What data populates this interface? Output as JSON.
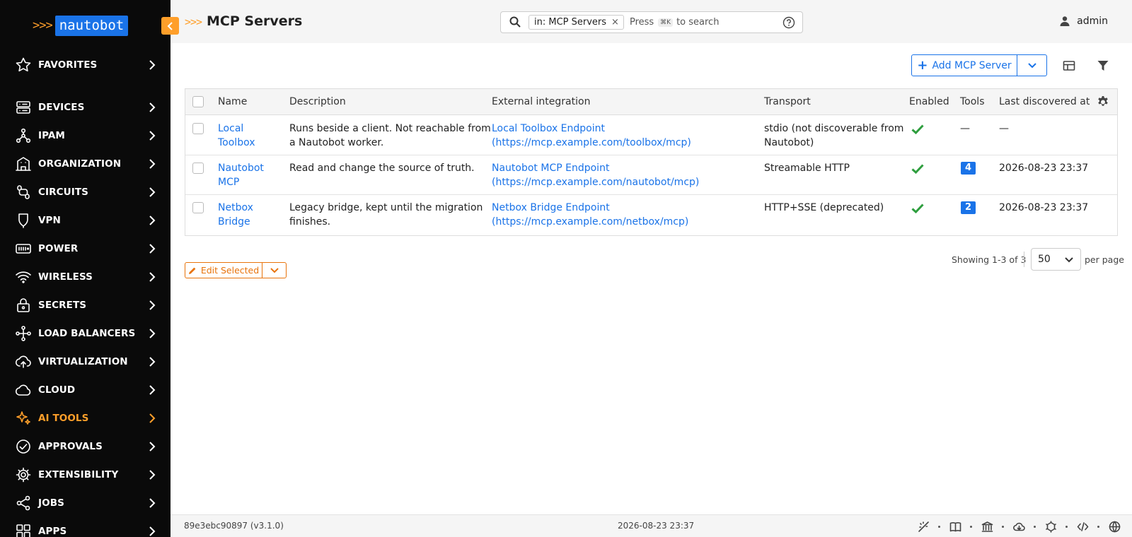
{
  "brand": {
    "chevrons": ">>>",
    "name": "nautobot"
  },
  "sidebar": {
    "items": [
      {
        "label": "FAVORITES",
        "icon": "star-icon"
      },
      {
        "label": "DEVICES",
        "icon": "server-icon"
      },
      {
        "label": "IPAM",
        "icon": "network-icon"
      },
      {
        "label": "ORGANIZATION",
        "icon": "building-icon"
      },
      {
        "label": "CIRCUITS",
        "icon": "circuit-icon"
      },
      {
        "label": "VPN",
        "icon": "shield-icon"
      },
      {
        "label": "POWER",
        "icon": "power-strip-icon"
      },
      {
        "label": "WIRELESS",
        "icon": "wifi-icon"
      },
      {
        "label": "SECRETS",
        "icon": "lock-icon"
      },
      {
        "label": "LOAD BALANCERS",
        "icon": "load-balancer-icon"
      },
      {
        "label": "VIRTUALIZATION",
        "icon": "cloud-upload-icon"
      },
      {
        "label": "CLOUD",
        "icon": "cloud-icon"
      },
      {
        "label": "AI TOOLS",
        "icon": "sparkle-icon",
        "active": true
      },
      {
        "label": "APPROVALS",
        "icon": "check-circle-icon"
      },
      {
        "label": "EXTENSIBILITY",
        "icon": "gear-icon"
      },
      {
        "label": "JOBS",
        "icon": "share-nodes-icon"
      },
      {
        "label": "APPS",
        "icon": "grid-icon"
      }
    ]
  },
  "header": {
    "title_chevrons": ">>>",
    "title": "MCP Servers",
    "search": {
      "chip": "in: MCP Servers",
      "chip_close": "×",
      "press": "Press",
      "shortcut": "⌘K",
      "suffix": "to search"
    },
    "user": "admin"
  },
  "toolbar": {
    "add_label": "Add MCP Server"
  },
  "table": {
    "columns": [
      "Name",
      "Description",
      "External integration",
      "Transport",
      "Enabled",
      "Tools",
      "Last discovered at"
    ],
    "rows": [
      {
        "name_line1": "Local",
        "name_line2": "Toolbox",
        "desc_line1": "Runs beside a client. Not reachable from",
        "desc_line2": "a Nautobot worker.",
        "ext_line1": "Local Toolbox Endpoint",
        "ext_line2": "(https://mcp.example.com/toolbox/mcp)",
        "transport_line1": "stdio (not discoverable from",
        "transport_line2": "Nautobot)",
        "enabled": true,
        "tools": "—",
        "tools_badge": false,
        "last": "—"
      },
      {
        "name_line1": "Nautobot",
        "name_line2": "MCP",
        "desc_line1": "Read and change the source of truth.",
        "desc_line2": "",
        "ext_line1": "Nautobot MCP Endpoint",
        "ext_line2": "(https://mcp.example.com/nautobot/mcp)",
        "transport_line1": "Streamable HTTP",
        "transport_line2": "",
        "enabled": true,
        "tools": "4",
        "tools_badge": true,
        "last": "2026-08-23 23:37"
      },
      {
        "name_line1": "Netbox",
        "name_line2": "Bridge",
        "desc_line1": "Legacy bridge, kept until the migration",
        "desc_line2": "finishes.",
        "ext_line1": "Netbox Bridge Endpoint",
        "ext_line2": "(https://mcp.example.com/netbox/mcp)",
        "transport_line1": "HTTP+SSE (deprecated)",
        "transport_line2": "",
        "enabled": true,
        "tools": "2",
        "tools_badge": true,
        "last": "2026-08-23 23:37"
      }
    ]
  },
  "bulk": {
    "edit_label": "Edit Selected"
  },
  "pagination": {
    "showing": "Showing 1-3 of 3",
    "per_page_value": "50",
    "per_page_label": "per page"
  },
  "footer": {
    "version": "89e3ebc90897 (v3.1.0)",
    "timestamp": "2026-08-23 23:37"
  },
  "colors": {
    "brand_orange": "#ff9f2a",
    "link_blue": "#1a73e8",
    "sidebar_bg": "#0a0a0a",
    "enabled_green": "#2e9e3e",
    "edit_orange": "#e8730b"
  }
}
